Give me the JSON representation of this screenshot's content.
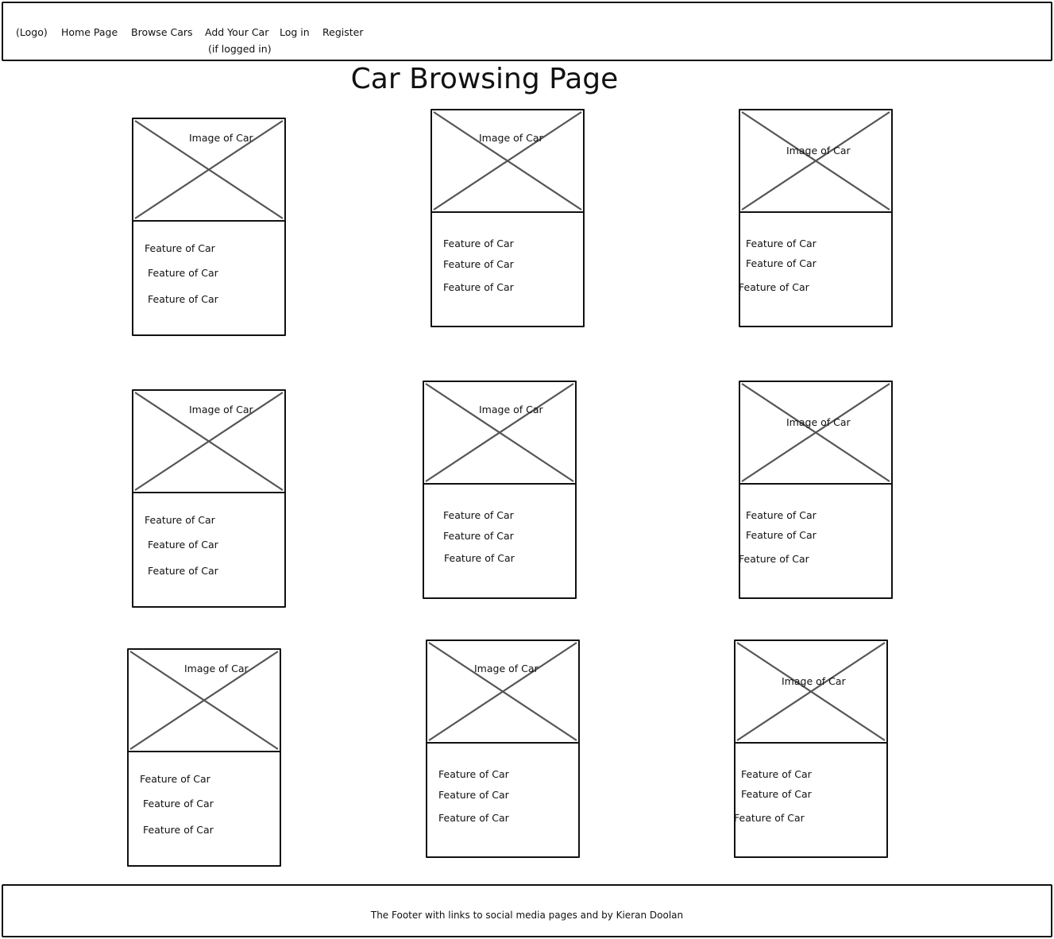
{
  "page": {
    "title": "Car Browsing Page"
  },
  "nav": {
    "logo": "(Logo)",
    "home": "Home Page",
    "browse": "Browse Cars",
    "add_car": "Add Your Car",
    "add_car_note": "(if logged in)",
    "login": "Log in",
    "register": "Register"
  },
  "cards": [
    {
      "image_label": "Image of Car",
      "features": [
        "Feature of Car",
        "Feature of Car",
        "Feature of Car"
      ]
    },
    {
      "image_label": "Image of Car",
      "features": [
        "Feature of Car",
        "Feature of Car",
        "Feature of Car"
      ]
    },
    {
      "image_label": "Image of Car",
      "features": [
        "Feature of Car",
        "Feature of Car",
        "Feature of Car"
      ]
    },
    {
      "image_label": "Image of Car",
      "features": [
        "Feature of Car",
        "Feature of Car",
        "Feature of Car"
      ]
    },
    {
      "image_label": "Image of Car",
      "features": [
        "Feature of Car",
        "Feature of Car",
        "Feature of Car"
      ]
    },
    {
      "image_label": "Image of Car",
      "features": [
        "Feature of Car",
        "Feature of Car",
        "Feature of Car"
      ]
    },
    {
      "image_label": "Image of Car",
      "features": [
        "Feature of Car",
        "Feature of Car",
        "Feature of Car"
      ]
    },
    {
      "image_label": "Image of Car",
      "features": [
        "Feature of Car",
        "Feature of Car",
        "Feature of Car"
      ]
    },
    {
      "image_label": "Image of Car",
      "features": [
        "Feature of Car",
        "Feature of Car",
        "Feature of Car"
      ]
    }
  ],
  "footer": {
    "text": "The Footer with links to social media pages and by Kieran Doolan"
  }
}
